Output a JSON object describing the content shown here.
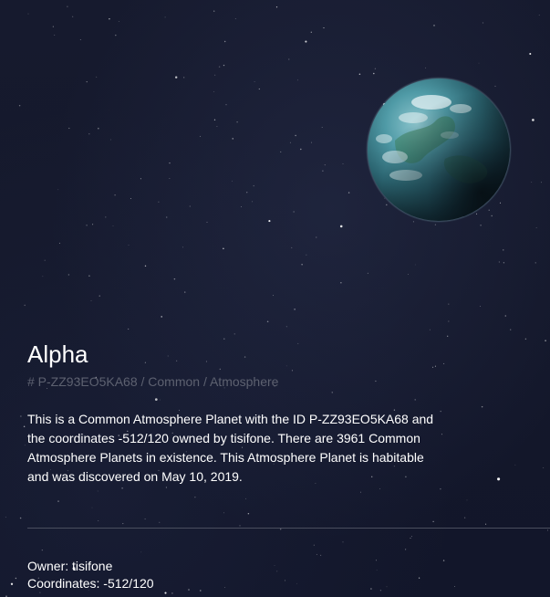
{
  "planet": {
    "name": "Alpha",
    "subtitle": "# P-ZZ93EO5KA68 / Common / Atmosphere",
    "description": "This is a Common Atmosphere Planet with the ID P-ZZ93EO5KA68 and the coordinates -512/120 owned by tisifone. There are 3961 Common Atmosphere Planets in existence. This Atmosphere Planet is habitable and was discovered on May 10, 2019."
  },
  "details": {
    "owner_label": "Owner:",
    "owner_value": "tisifone",
    "coordinates_label": "Coordinates:",
    "coordinates_value": "-512/120"
  },
  "colors": {
    "background": "#13172a",
    "text": "#ffffff",
    "subtitle": "#5d6170",
    "divider": "#4a4e5e"
  },
  "icons": {
    "planet": "atmosphere-planet-image"
  }
}
